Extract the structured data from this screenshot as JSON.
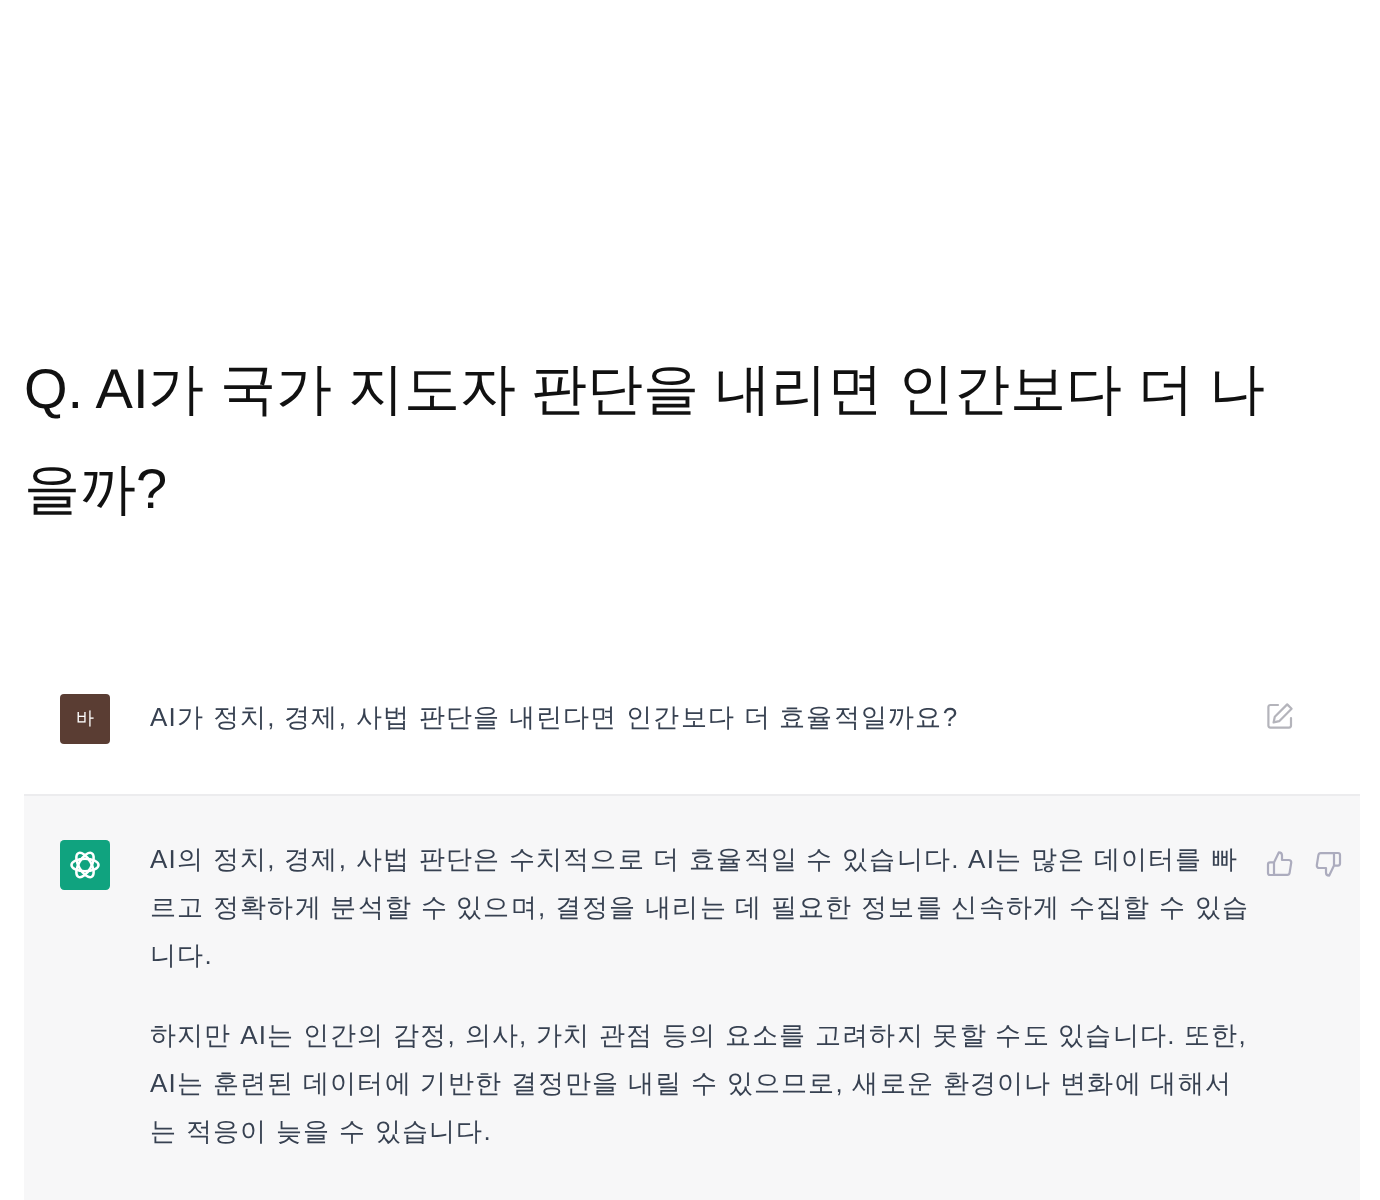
{
  "article": {
    "question": "Q. AI가 국가 지도자 판단을 내리면 인간보다 더 나을까?"
  },
  "chat": {
    "messages": [
      {
        "kind": "prompt",
        "avatar": "바",
        "text": "AI가 정치, 경제, 사법 판단을 내린다면 인간보다 더 효율적일까요?"
      },
      {
        "kind": "reply",
        "paragraphs": [
          "AI의 정치, 경제, 사법 판단은 수치적으로 더 효율적일 수 있습니다. AI는 많은 데이터를 빠르고 정확하게 분석할 수 있으며, 결정을 내리는 데 필요한 정보를 신속하게 수집할 수 있습니다.",
          "하지만 AI는 인간의 감정, 의사, 가치 관점 등의 요소를 고려하지 못할 수도 있습니다. 또한, AI는 훈련된 데이터에 기반한 결정만을 내릴 수 있으므로, 새로운 환경이나 변화에 대해서는 적응이 늦을 수 있습니다."
        ]
      }
    ]
  }
}
